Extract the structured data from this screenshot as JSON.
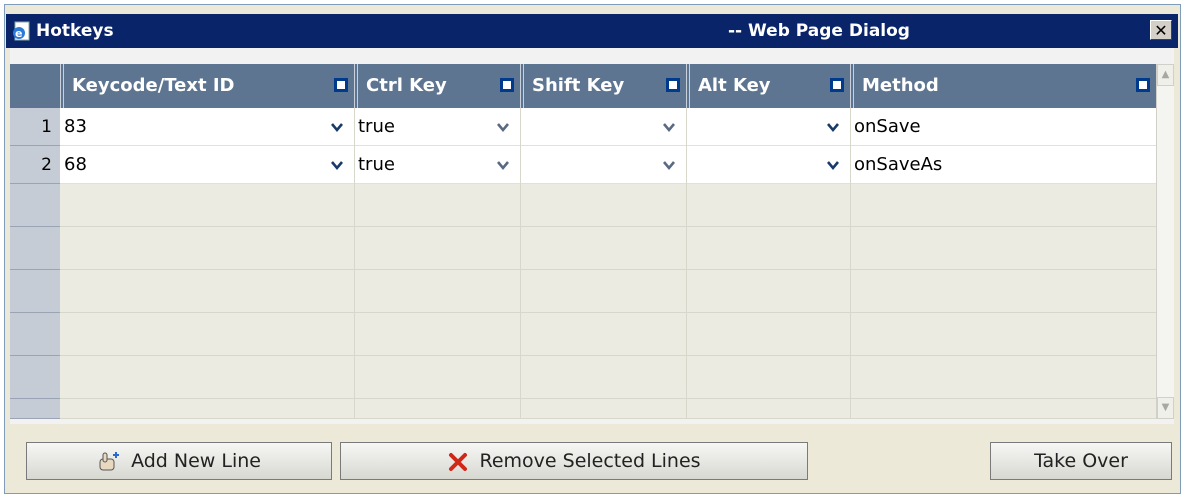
{
  "window": {
    "title": "Hotkeys",
    "subtitle": "-- Web Page Dialog",
    "close_glyph": "✕"
  },
  "columns": [
    {
      "label": "Keycode/Text ID"
    },
    {
      "label": "Ctrl Key"
    },
    {
      "label": "Shift Key"
    },
    {
      "label": "Alt Key"
    },
    {
      "label": "Method"
    }
  ],
  "rows": [
    {
      "num": "1",
      "keycode": "83",
      "ctrl": "true",
      "shift": "",
      "alt": "",
      "method": "onSave"
    },
    {
      "num": "2",
      "keycode": "68",
      "ctrl": "true",
      "shift": "",
      "alt": "",
      "method": "onSaveAs"
    }
  ],
  "buttons": {
    "add": "Add New Line",
    "remove": "Remove Selected Lines",
    "takeover": "Take Over"
  },
  "icons": {
    "title": "ie-page-icon",
    "add": "hand-pointer-icon",
    "remove": "red-x-icon"
  },
  "colors": {
    "title_bar": "#0a246a",
    "header": "#5e7592",
    "row_header": "#c6ccd6"
  }
}
